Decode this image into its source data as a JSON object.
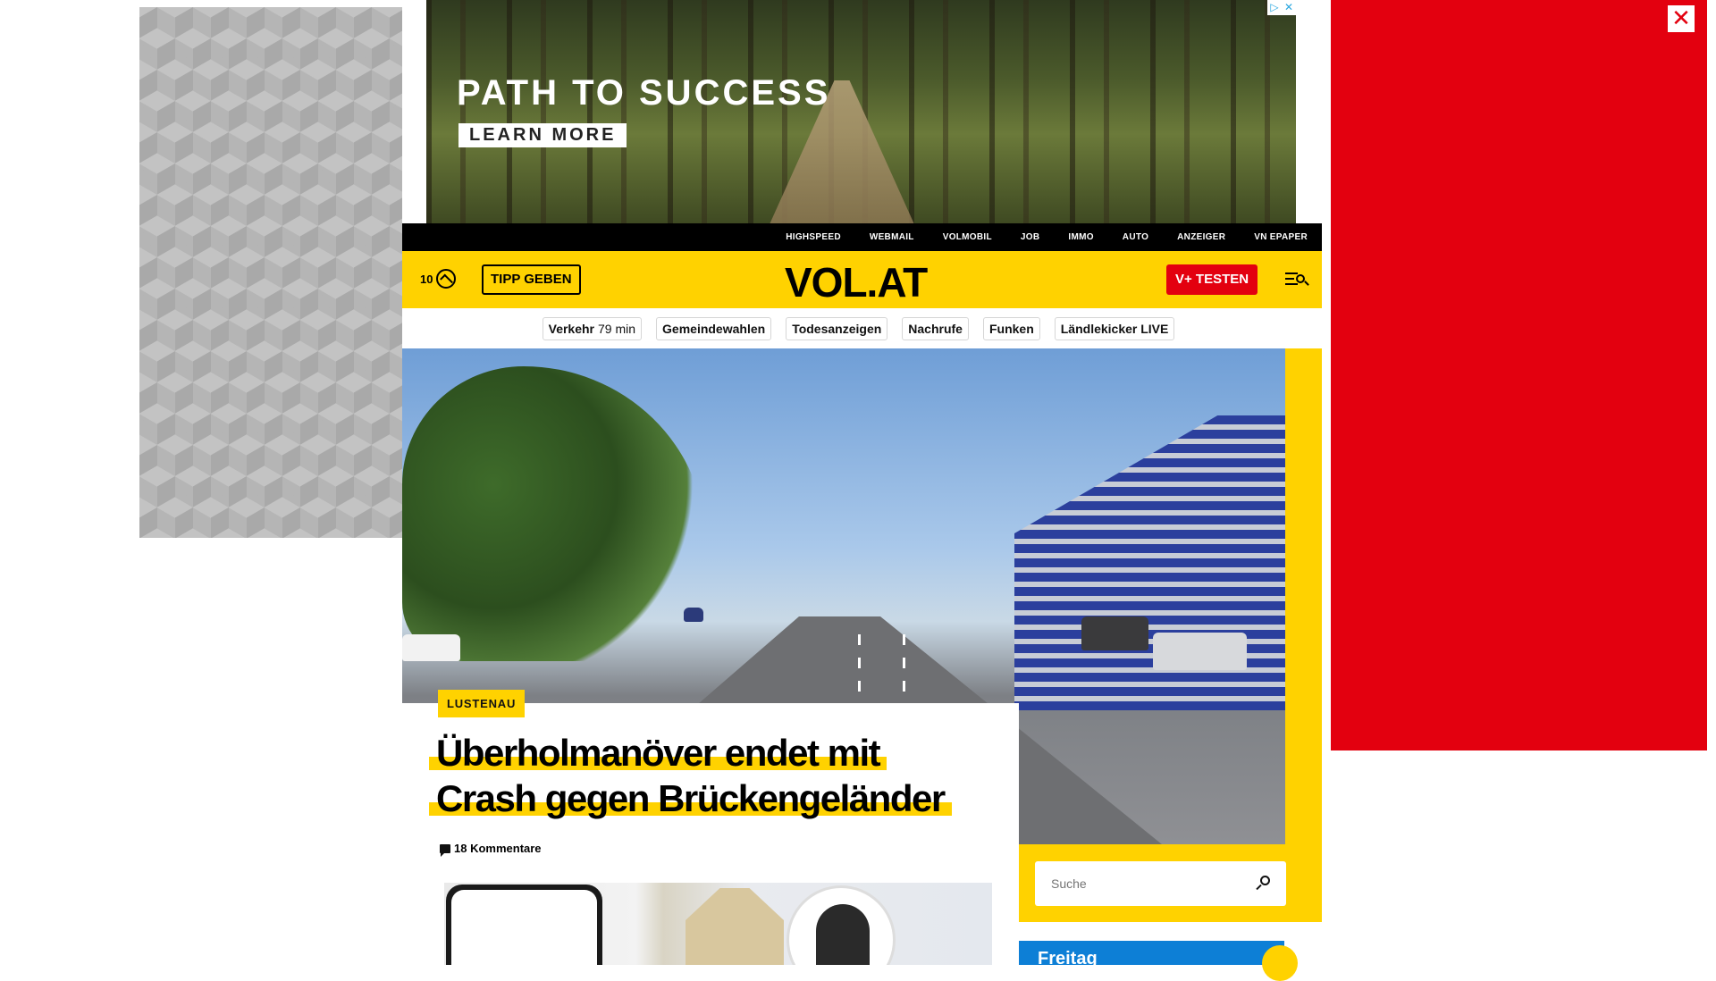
{
  "top_ad": {
    "headline": "PATH TO SUCCESS",
    "cta": "LEARN MORE",
    "adchoices": [
      "▷",
      "✕"
    ]
  },
  "close_symbol": "✕",
  "topnav": {
    "items": [
      "HIGHSPEED",
      "WEBMAIL",
      "VOLMOBIL",
      "JOB",
      "IMMO",
      "AUTO",
      "ANZEIGER",
      "VN EPAPER"
    ]
  },
  "header": {
    "weather_temp": "10",
    "tipp_label": "TIPP GEBEN",
    "logo": "VOL.AT",
    "vplus_label": "V+ TESTEN"
  },
  "quicklinks": [
    {
      "label": "Verkehr",
      "sub": "79 min"
    },
    {
      "label": "Gemeindewahlen",
      "sub": ""
    },
    {
      "label": "Todesanzeigen",
      "sub": ""
    },
    {
      "label": "Nachrufe",
      "sub": ""
    },
    {
      "label": "Funken",
      "sub": ""
    },
    {
      "label": "Ländlekicker LIVE",
      "sub": ""
    }
  ],
  "article": {
    "category": "LUSTENAU",
    "headline_line1": "Überholmanöver endet mit",
    "headline_line2": "Crash gegen Brückengeländer",
    "comments": "18 Kommentare"
  },
  "search": {
    "placeholder": "Suche"
  },
  "side_card": {
    "title": "Freitag"
  },
  "colors": {
    "brand_yellow": "#ffd200",
    "brand_red": "#e3000f",
    "nav_black": "#000000",
    "weather_blue": "#0d7fd6"
  }
}
